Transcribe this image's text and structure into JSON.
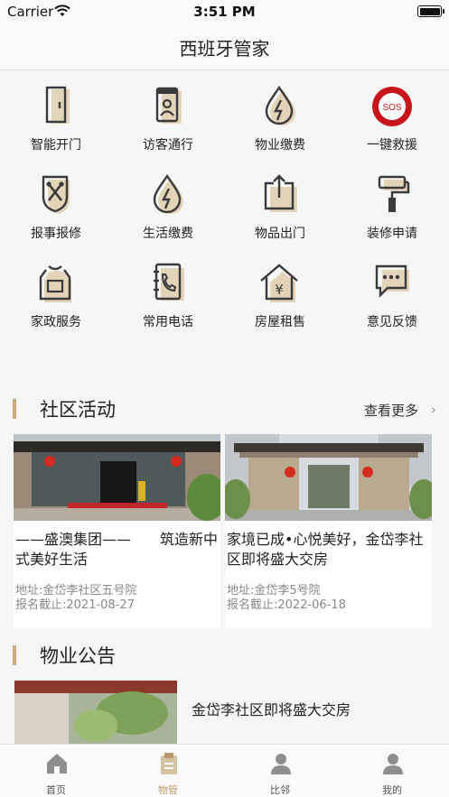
{
  "status_bar": {
    "carrier": "Carrier",
    "time": "3:51 PM"
  },
  "nav": {
    "title": "西班牙管家"
  },
  "services": [
    {
      "label": "智能开门",
      "icon": "door-icon"
    },
    {
      "label": "访客通行",
      "icon": "visitor-pass-icon"
    },
    {
      "label": "物业缴费",
      "icon": "utility-drop-icon"
    },
    {
      "label": "一键救援",
      "icon": "sos-icon",
      "icon_text": "SOS"
    },
    {
      "label": "报事报修",
      "icon": "repair-tools-icon"
    },
    {
      "label": "生活缴费",
      "icon": "life-payment-icon"
    },
    {
      "label": "物品出门",
      "icon": "item-exit-icon"
    },
    {
      "label": "装修申请",
      "icon": "paint-roller-icon"
    },
    {
      "label": "家政服务",
      "icon": "housekeeping-apron-icon"
    },
    {
      "label": "常用电话",
      "icon": "phone-book-icon"
    },
    {
      "label": "房屋租售",
      "icon": "house-rent-icon",
      "icon_text": "¥"
    },
    {
      "label": "意见反馈",
      "icon": "feedback-chat-icon"
    }
  ],
  "community": {
    "title": "社区活动",
    "more": "查看更多",
    "cards": [
      {
        "title": "——盛澳集团——　　筑造新中式美好生活",
        "address": "地址:金岱李社区五号院",
        "deadline": "报名截止:2021-08-27"
      },
      {
        "title": "家境已成•心悦美好，金岱李社区即将盛大交房",
        "address": "地址:金岱李5号院",
        "deadline": "报名截止:2022-06-18"
      }
    ]
  },
  "notice": {
    "title": "物业公告",
    "items": [
      {
        "title": "金岱李社区即将盛大交房"
      }
    ]
  },
  "tabbar": {
    "active": 1,
    "tabs": [
      {
        "label": "首页",
        "icon": "home-icon"
      },
      {
        "label": "物管",
        "icon": "property-clipboard-icon"
      },
      {
        "label": "比邻",
        "icon": "neighbor-icon"
      },
      {
        "label": "我的",
        "icon": "profile-icon"
      }
    ]
  },
  "colors": {
    "accent": "#c9a97a",
    "sos_red": "#c8151b",
    "icon_stroke": "#3a3a3a",
    "icon_shadow": "#e3d3b8"
  }
}
